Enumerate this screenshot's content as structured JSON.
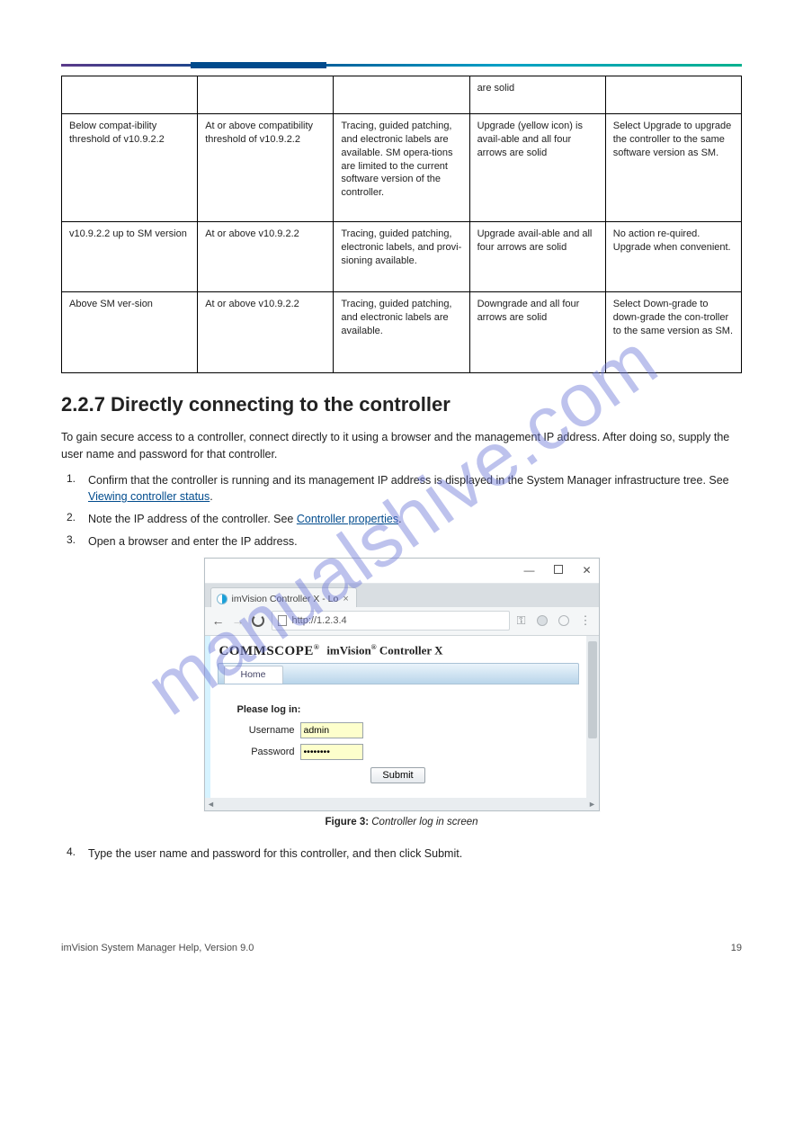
{
  "watermark": "manualshive.com",
  "table": {
    "rows": [
      {
        "cls": "h",
        "cells": [
          "",
          "",
          "",
          "are solid",
          ""
        ]
      },
      {
        "cls": "t",
        "cells": [
          "Below compat-ibility threshold of v10.9.2.2",
          "At or above compatibility threshold of v10.9.2.2",
          "Tracing, guided patching, and electronic labels are available. SM opera-tions are limited to the current software version of the controller.",
          "Upgrade (yellow icon) is avail-able and all four arrows are solid",
          "Select Upgrade to upgrade the controller to the same software version as SM."
        ]
      },
      {
        "cls": "m",
        "cells": [
          "v10.9.2.2 up to SM version",
          "At or above v10.9.2.2",
          "Tracing, guided patching, electronic labels, and provi-sioning available.",
          "Upgrade avail-able and all four arrows are solid",
          "No action re-quired. Upgrade when convenient."
        ]
      },
      {
        "cls": "b",
        "cells": [
          "Above SM ver-sion",
          "At or above v10.9.2.2",
          "Tracing, guided patching, and electronic labels are available.",
          "Downgrade and all four arrows are solid",
          "Select Down-grade to down-grade the con-troller to the same version as SM."
        ]
      }
    ]
  },
  "section_heading": "2.2.7 Directly connecting to the controller",
  "intro": "To gain secure access to a controller, connect directly to it using a browser and the management IP address. After doing so, supply the user name and password for that controller.",
  "steps": [
    {
      "n": "1.",
      "text_pre": "Confirm that the controller is running and its management IP address is displayed in the System Manager infrastructure tree. See ",
      "link": "Viewing controller status",
      "text_post": "."
    },
    {
      "n": "2.",
      "text_pre": "Note the IP address of the controller. See ",
      "link": "Controller properties",
      "text_post": "."
    },
    {
      "n": "3.",
      "text_pre": "Open a browser and enter the IP address.",
      "link": "",
      "text_post": ""
    }
  ],
  "browser": {
    "tab_title": "imVision Controller X - Lo",
    "url_text": "http://1.2.3.4",
    "brand_main": "COMMSCOPE",
    "brand_reg": "®",
    "brand_product_pre": "imVision",
    "brand_product_reg": "®",
    "brand_product_post": " Controller X",
    "home_tab": "Home",
    "login_header": "Please log in:",
    "username_label": "Username",
    "username_value": "admin",
    "password_label": "Password",
    "password_value": "••••••••",
    "submit_label": "Submit",
    "key_icon": "⚿"
  },
  "figure": {
    "num": "Figure 3:",
    "caption": "Controller log in screen"
  },
  "continue_steps": [
    {
      "n": "4.",
      "text": "Type the user name and password for this controller, and then click Submit."
    }
  ],
  "footer": {
    "left": "imVision System Manager Help, Version 9.0",
    "right": "19"
  }
}
